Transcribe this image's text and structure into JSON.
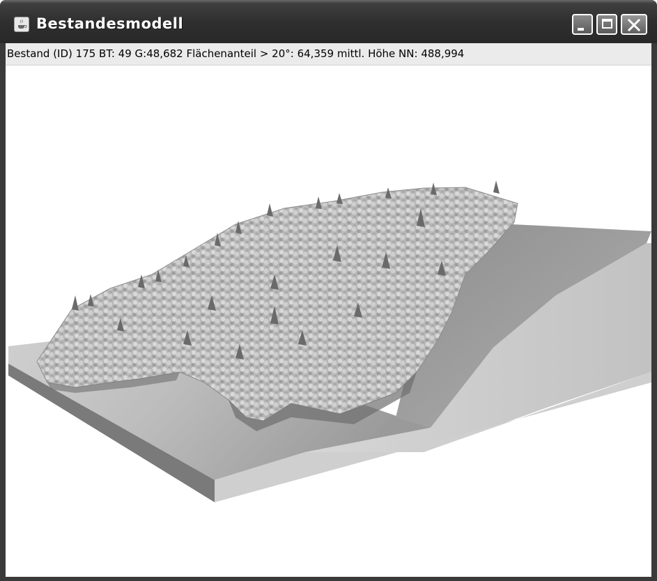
{
  "window": {
    "title": "Bestandesmodell",
    "icon": "java-cup-icon"
  },
  "status": {
    "text": "Bestand (ID) 175 BT: 49 G:48,682 Flächenanteil > 20°: 64,359 mittl. Höhe NN: 488,994"
  },
  "colors": {
    "titlebar": "#2f2f2f",
    "status_background": "#ebebeb",
    "terrain_light": "#c8c8c8",
    "terrain_dark": "#8a8a8a",
    "canopy": "#bdbdbd"
  }
}
